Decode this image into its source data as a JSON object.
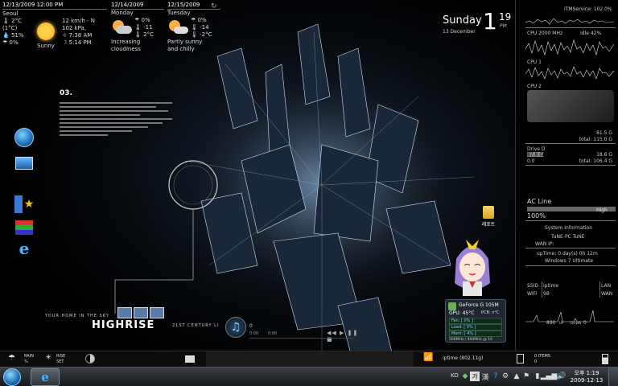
{
  "weather": {
    "date_time": "12/13/2009 12:00 PM",
    "city": "Seoul",
    "current": {
      "temp": "2°C",
      "temp_feel": "(1°C)",
      "humidity": "51%",
      "precip": "0%",
      "wind": "12 km/h - N",
      "pressure": "102 kPa,",
      "sunrise": "7:38 AM",
      "sunset": "5:14 PM",
      "condition": "Sunny"
    },
    "forecast": [
      {
        "date": "12/14/2009",
        "day": "Monday",
        "precip": "0%",
        "high": "-11",
        "low": "2°C",
        "desc1": "Increasing",
        "desc2": "cloudiness"
      },
      {
        "date": "12/15/2009",
        "day": "Tuesday",
        "precip": "0%",
        "high": "-14",
        "low": "-2°C",
        "desc1": "Partly sunny",
        "desc2": "and chilly"
      }
    ]
  },
  "clock": {
    "day": "Sunday",
    "date": "13 December",
    "hour": "1",
    "minute": "19",
    "ampm": "PM"
  },
  "notes": {
    "title": "03."
  },
  "right_panel": {
    "itm_label": "ITMService: 102.0%",
    "cpu_label": "CPU 2000 MHz",
    "idle_label": "Idle 42%",
    "cpu1_label": "CPU 1",
    "cpu2_label": "CPU 2",
    "drive_c_val": "81.5 G",
    "drive_c_total": "total: 115.0 G",
    "drive_d_label": "Drive D",
    "drive_d_used": "87.8 G",
    "drive_d_val": "18.6 G",
    "drive_d_free": "0.0",
    "drive_d_total": "total: 106.4 G",
    "power_label": "AC Line",
    "power_state": "High",
    "power_pct": "100%",
    "sys_title": "System Information",
    "sys_name": "TuNE-PC  TuNE",
    "wan_ip": "WAN IP:",
    "uptime": "upTime: 0 day(s) 0h 12m",
    "os": "Windows 7 Ultimate",
    "ssid_label": "SSID",
    "ssid_val": "iptime",
    "lan_label": "LAN",
    "wifi_label": "WiFi",
    "wifi_val": "98",
    "wan_label": "WAN",
    "net_val": "890",
    "up_label": "UP",
    "down_label": "DOWN",
    "down_val": "0"
  },
  "desktop": {
    "folder_label": "레포트",
    "wallpaper_tagline": "YOUR HOME IN THE SKY",
    "wallpaper_title": "HIGHRISE",
    "wallpaper_sub": "21ST CENTURY LI"
  },
  "media": {
    "time": "0",
    "position": "0:00",
    "duration": "0:00"
  },
  "gpu": {
    "model": "GeForce G 105M",
    "gpu_temp": "GPU: 45°C",
    "pcb_temp": "PCB: n°C",
    "fan": "Fan: [ 0% ]",
    "load": "Load: [ 0% ]",
    "mem": "Mem: [ 4% ]",
    "clock": "500MHz / 400MHz @ 16"
  },
  "bottom_bar": {
    "rain_label": "RAIN",
    "rain_val": "%",
    "rise_label": "RISE",
    "set_label": "SET",
    "network_name": "iptime  (802.11g)",
    "recycle": "0 ITEMS",
    "recycle_sub": "0"
  },
  "taskbar": {
    "lang": "KO",
    "ime": "가",
    "clock_time": "오후 1:19",
    "clock_date": "2009-12-13"
  },
  "colors": {
    "accent": "#6fa8dc",
    "graph": "#cfcfcf"
  }
}
